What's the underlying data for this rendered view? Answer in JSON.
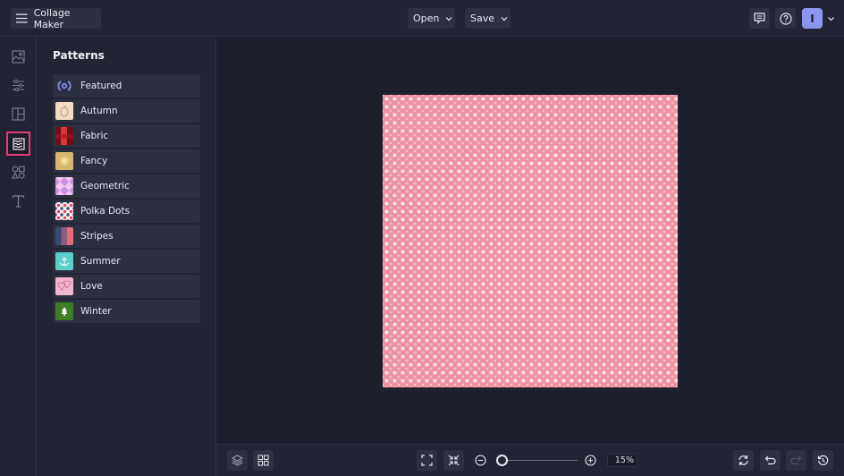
{
  "header": {
    "app_title": "Collage Maker",
    "open_label": "Open",
    "save_label": "Save",
    "avatar_initial": "I"
  },
  "rail": {
    "items": [
      {
        "name": "photos",
        "icon": "image-icon"
      },
      {
        "name": "adjustments",
        "icon": "sliders-icon"
      },
      {
        "name": "layouts",
        "icon": "layout-icon"
      },
      {
        "name": "patterns",
        "icon": "pattern-icon",
        "active": true
      },
      {
        "name": "graphics",
        "icon": "shapes-icon"
      },
      {
        "name": "text",
        "icon": "text-icon"
      }
    ]
  },
  "panel": {
    "title": "Patterns",
    "categories": [
      {
        "label": "Featured",
        "thumb": "featured-badge"
      },
      {
        "label": "Autumn",
        "thumb": "autumn"
      },
      {
        "label": "Fabric",
        "thumb": "fabric"
      },
      {
        "label": "Fancy",
        "thumb": "fancy"
      },
      {
        "label": "Geometric",
        "thumb": "geometric"
      },
      {
        "label": "Polka Dots",
        "thumb": "polka-dots"
      },
      {
        "label": "Stripes",
        "thumb": "stripes"
      },
      {
        "label": "Summer",
        "thumb": "summer"
      },
      {
        "label": "Love",
        "thumb": "love"
      },
      {
        "label": "Winter",
        "thumb": "winter"
      }
    ]
  },
  "canvas": {
    "pattern_base_color": "#ef8f9f",
    "pattern_dot_color": "#ffffff"
  },
  "footer": {
    "zoom_level": "15%",
    "zoom_slider_value_percent": 15
  },
  "colors": {
    "accent_active": "#e63c74",
    "avatar": "#8b96f0"
  }
}
